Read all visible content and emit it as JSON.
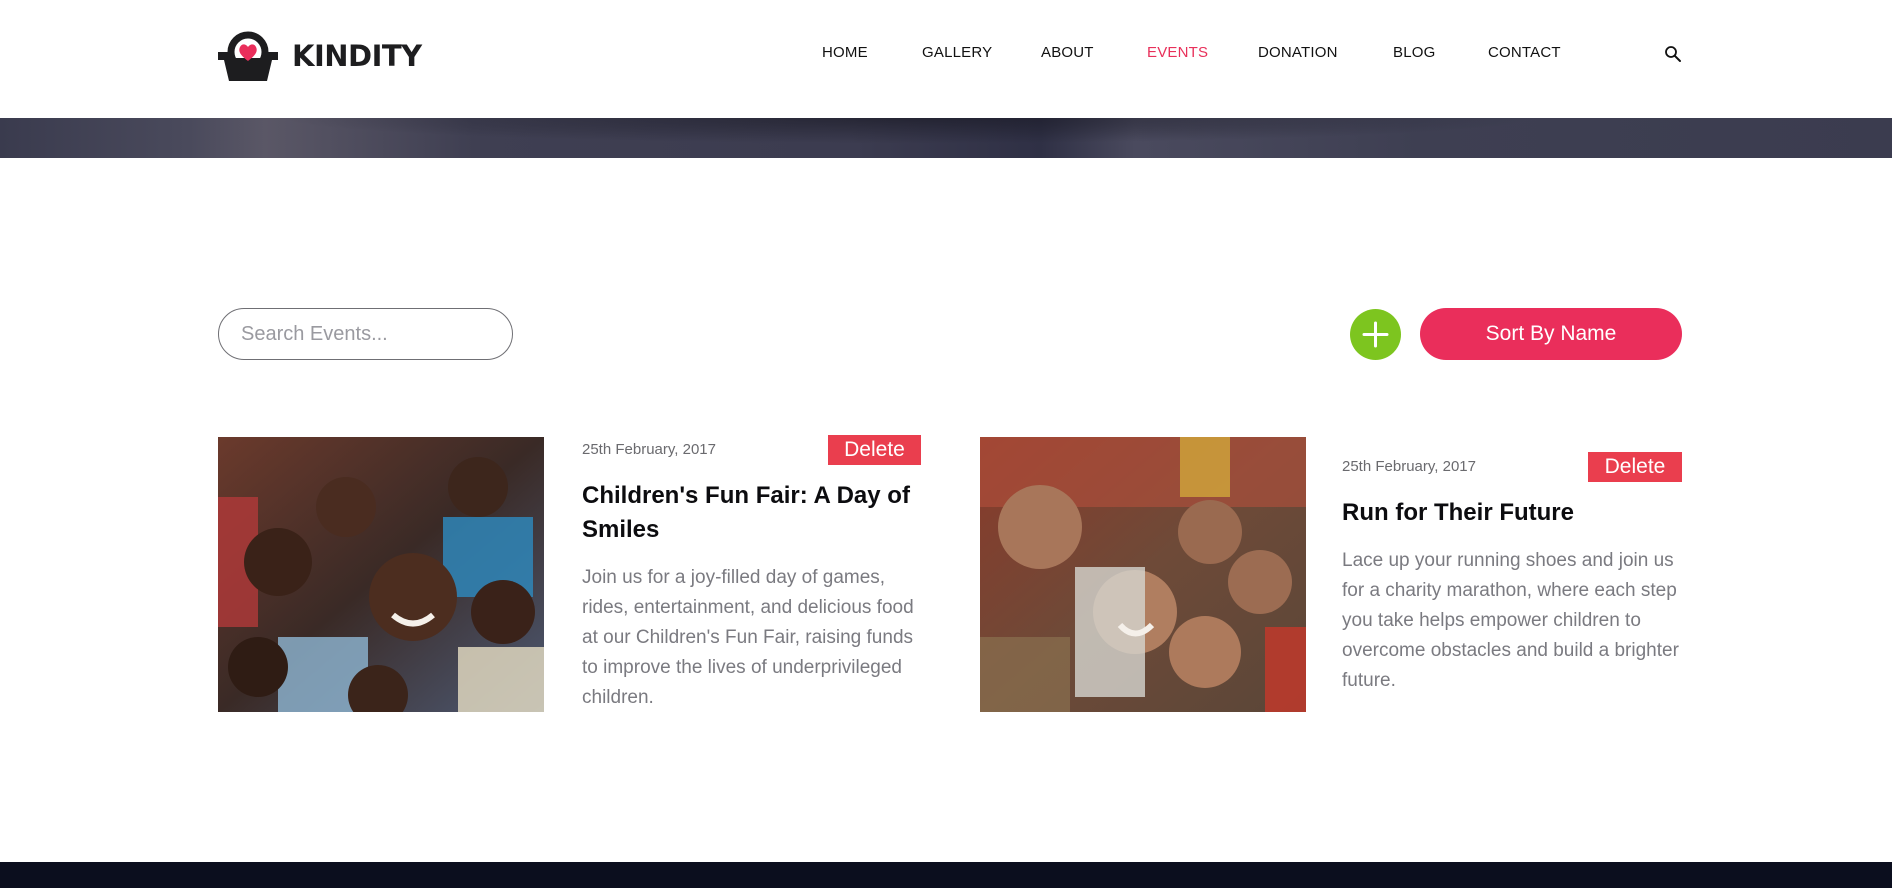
{
  "brand": {
    "name": "KINDITY",
    "accent": "#ea2e5b"
  },
  "nav": [
    {
      "label": "HOME",
      "active": false
    },
    {
      "label": "GALLERY",
      "active": false
    },
    {
      "label": "ABOUT",
      "active": false
    },
    {
      "label": "EVENTS",
      "active": true
    },
    {
      "label": "DONATION",
      "active": false
    },
    {
      "label": "BLOG",
      "active": false
    },
    {
      "label": "CONTACT",
      "active": false
    }
  ],
  "header": {
    "search_icon": "search-icon"
  },
  "toolbar": {
    "search_placeholder": "Search Events...",
    "search_value": "",
    "add_icon": "plus-icon",
    "add_color": "#7dc51f",
    "sort_label": "Sort By Name"
  },
  "events": [
    {
      "date": "25th February, 2017",
      "delete_label": "Delete",
      "title": "Children's Fun Fair: A Day of Smiles",
      "description": "Join us for a joy-filled day of games, rides, entertainment, and delicious food at our Children's Fun Fair, raising funds to improve the lives of underprivileged children.",
      "image": "photo of a group of smiling children"
    },
    {
      "date": "25th February, 2017",
      "delete_label": "Delete",
      "title": "Run for Their Future",
      "description": "Lace up your running shoes and join us for a charity marathon, where each step you take helps empower children to overcome obstacles and build a brighter future.",
      "image": "photo of children making peace signs"
    }
  ]
}
